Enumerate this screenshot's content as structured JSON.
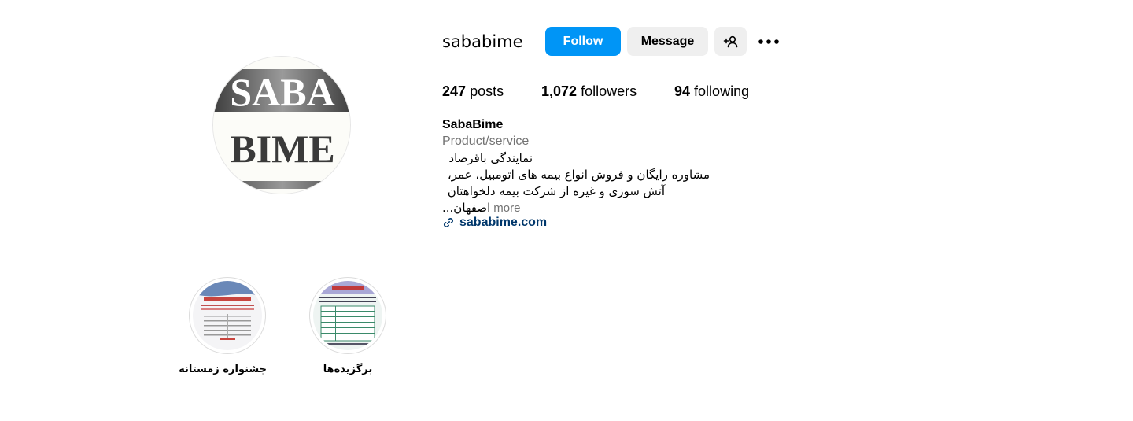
{
  "profile": {
    "username": "sababime",
    "avatar_text": {
      "line1": "SABA",
      "line2": "BIME"
    },
    "full_name": "SabaBime",
    "category": "Product/service",
    "bio_lines": [
      "نمایندگی باقرصاد",
      "مشاوره رایگان و فروش انواع بیمه های اتومبیل، عمر،",
      "آتش سوزی و غیره از شرکت بیمه دلخواهتان",
      "اصفهان..."
    ],
    "more_label": "more",
    "website": "sababime.com"
  },
  "actions": {
    "follow_label": "Follow",
    "message_label": "Message",
    "add_user_icon": "person-add-icon",
    "more_icon": "more-horizontal-icon"
  },
  "stats": {
    "posts_count": "247",
    "posts_label": "posts",
    "followers_count": "1,072",
    "followers_label": "followers",
    "following_count": "94",
    "following_label": "following"
  },
  "highlights": [
    {
      "label": "جشنواره زمستانه"
    },
    {
      "label": "برگزیده‌ها"
    }
  ],
  "colors": {
    "primary": "#0095f6",
    "secondary_button": "#efefef",
    "link": "#00376b",
    "muted": "#737373"
  }
}
